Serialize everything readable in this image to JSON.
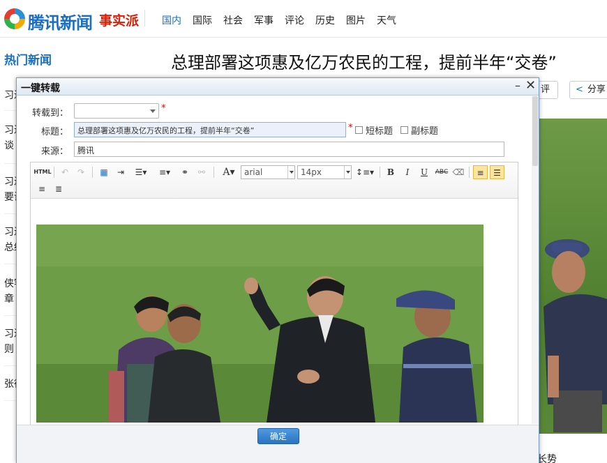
{
  "header": {
    "brand": "腾讯新闻",
    "brand_sub": "事实派",
    "nav": [
      "国内",
      "国际",
      "社会",
      "军事",
      "评论",
      "历史",
      "图片",
      "天气"
    ]
  },
  "sidebar": {
    "title": "热门新闻",
    "items": [
      "习近",
      "习近\n谈",
      "习近\n要讲",
      "习近\n总结",
      "侠客\n章",
      "习近\n则",
      "张德"
    ]
  },
  "article": {
    "title": "总理部署这项惠及亿万农民的工程，提前半年“交卷”",
    "comment_label": "评论",
    "share_label": "分享",
    "bottom_text": "长势"
  },
  "dialog": {
    "title": "一键转载",
    "minimize": "–",
    "close": "✕",
    "fields": {
      "repost_to_label": "转载到：",
      "repost_to_value": "",
      "title_label": "标题：",
      "title_value": "总理部署这项惠及亿万农民的工程，提前半年“交卷”",
      "short_title_label": "短标题",
      "sub_title_label": "副标题",
      "source_label": "来源：",
      "source_value": "腾讯",
      "required_mark": "*"
    },
    "toolbar": {
      "html": "HTML",
      "font_family": "arial",
      "font_size": "14px",
      "font_color": "A",
      "bold": "B",
      "italic": "I",
      "underline": "U",
      "strike": "ABC"
    },
    "ok_label": "确定"
  },
  "colors": {
    "brand_blue": "#1a6fc3",
    "brand_red": "#d81e06",
    "grass": "#6c9b45"
  }
}
